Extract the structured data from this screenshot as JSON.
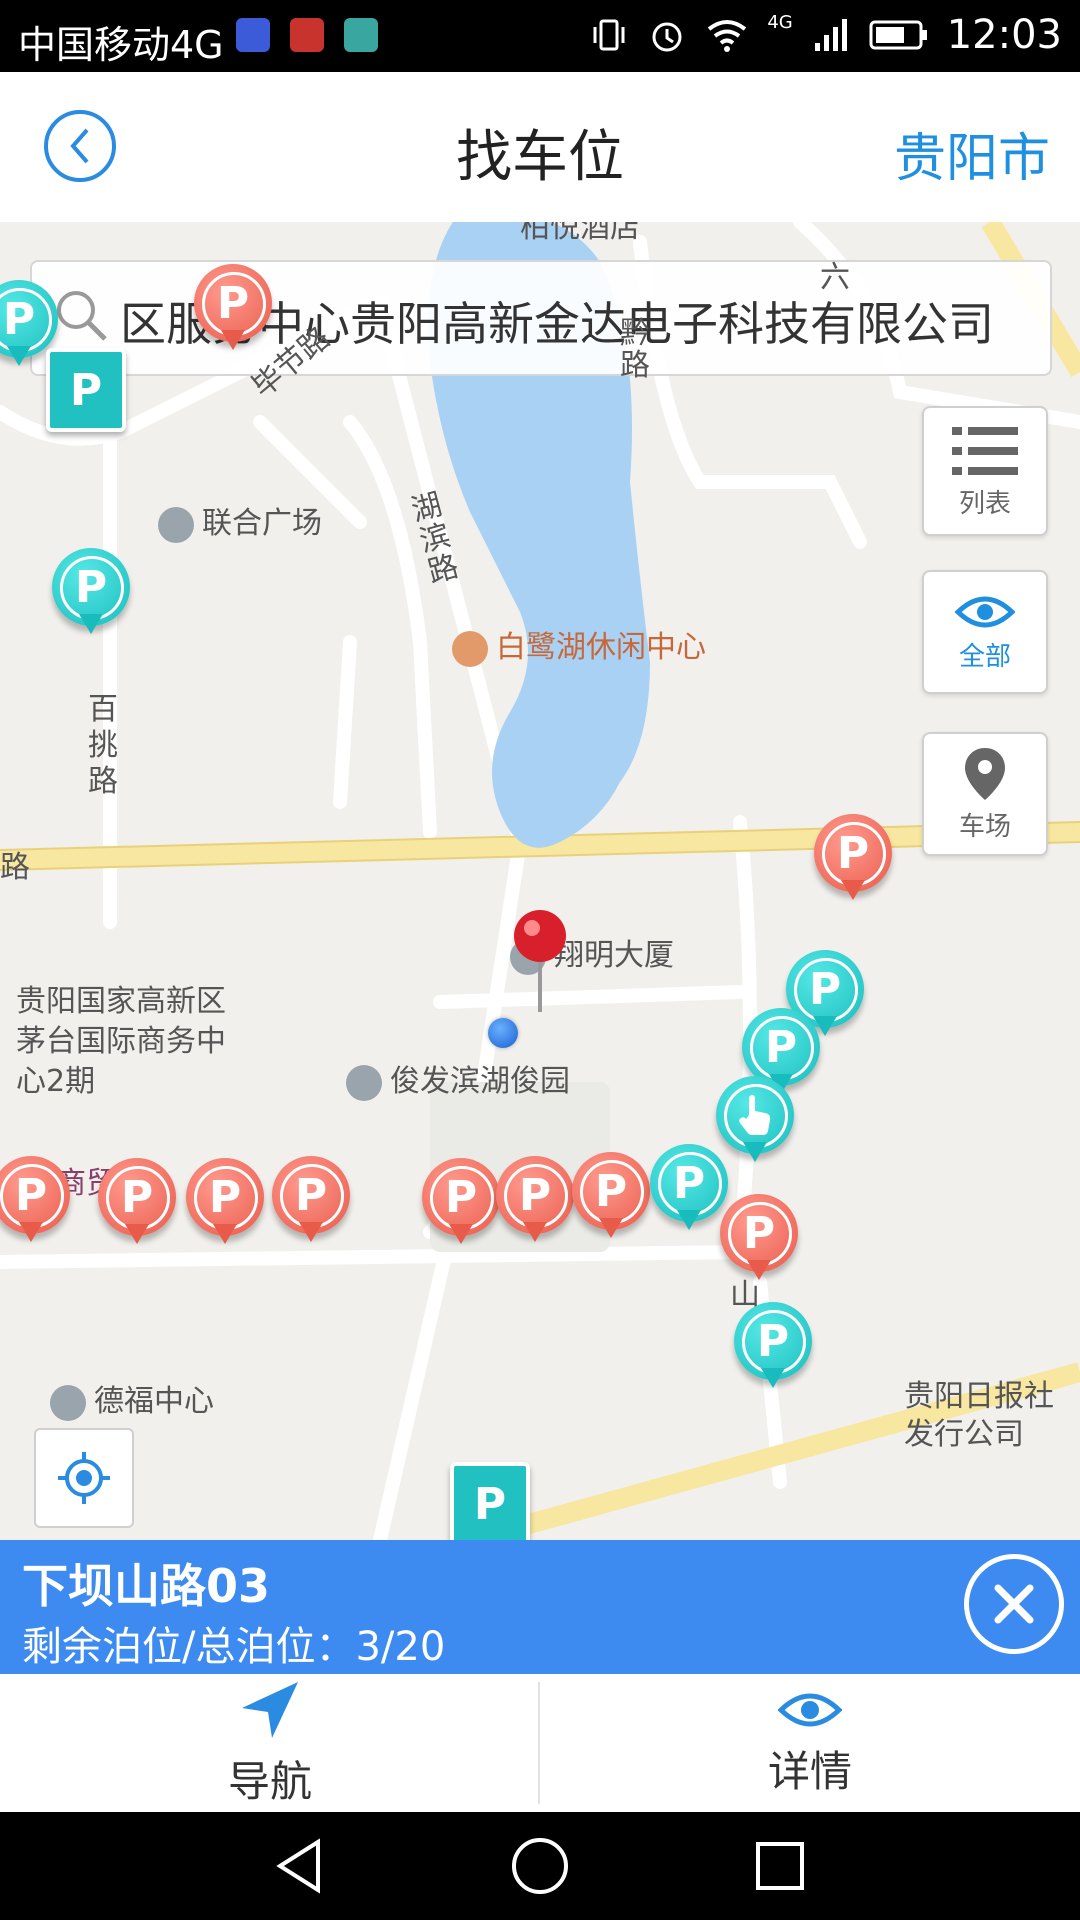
{
  "status_bar": {
    "carrier": "中国移动4G",
    "network": "4G",
    "time": "12:03"
  },
  "header": {
    "title": "找车位",
    "city": "贵阳市"
  },
  "search": {
    "query": "区服务中心贵阳高新金达电子科技有限公司"
  },
  "side_buttons": {
    "list": "列表",
    "all": "全部",
    "lots": "车场"
  },
  "map": {
    "places": [
      {
        "id": "lianhe",
        "text": "联合广场"
      },
      {
        "id": "bailu",
        "text": "白鹭湖休闲中心"
      },
      {
        "id": "xiangming",
        "text": "翔明大厦"
      },
      {
        "id": "junfa",
        "text": "俊发滨湖俊园"
      },
      {
        "id": "guiyang_hitech",
        "text": "贵阳国家高新区茅台国际商务中心2期"
      },
      {
        "id": "defu",
        "text": "德福中心"
      },
      {
        "id": "ribao",
        "text": "贵阳日报社发行公司"
      }
    ],
    "roads": [
      {
        "id": "hubin",
        "text": "湖滨路"
      },
      {
        "id": "baitiao",
        "text": "百挑路"
      },
      {
        "id": "bijie",
        "text": "毕节路"
      },
      {
        "id": "qian",
        "text": "黔路"
      },
      {
        "id": "lu_left",
        "text": "路"
      },
      {
        "id": "shangmao",
        "text": "商贸"
      },
      {
        "id": "top_hotel",
        "text": "柏悦酒店"
      },
      {
        "id": "shan",
        "text": "山"
      },
      {
        "id": "liu",
        "text": "六"
      }
    ],
    "parking_marker_glyph": "P"
  },
  "selected_lot": {
    "name": "下坝山路03",
    "label": "剩余泊位/总泊位：",
    "value": "3/20"
  },
  "actions": {
    "navigate": "导航",
    "details": "详情"
  },
  "colors": {
    "accent": "#1f8fe0",
    "panel": "#3d8bf0",
    "pin_red": "#e85a4a",
    "pin_teal": "#19bcbc",
    "lake": "#a8d1f4",
    "road_main": "#f5e6a8"
  }
}
